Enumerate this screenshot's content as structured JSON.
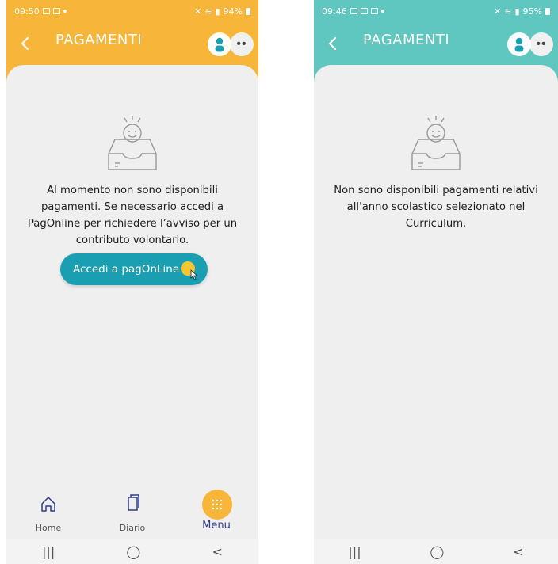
{
  "left_screen": {
    "status": {
      "time": "09:50",
      "battery": "94%"
    },
    "title": "PAGAMENTI",
    "message": "Al momento non sono disponibili pagamenti. Se necessario accedi a PagOnline per richiedere l’avviso per un contributo volontario.",
    "button_label": "Accedi a pagOnLine",
    "nav": {
      "home": "Home",
      "diario": "Diario",
      "menu": "Menu"
    },
    "colors": {
      "header": "#f7b63a",
      "button": "#1a9fb2",
      "menu_circle": "#f7b63a"
    }
  },
  "right_screen": {
    "status": {
      "time": "09:46",
      "battery": "95%"
    },
    "title": "PAGAMENTI",
    "message": "Non sono disponibili pagamenti relativi all'anno scolastico selezionato nel Curriculum.",
    "colors": {
      "header": "#5fc6c0"
    }
  },
  "icons": {
    "back": "chevron-left-icon",
    "avatar": "user-avatar-icon",
    "more": "more-dots-icon",
    "empty": "empty-inbox-icon",
    "home": "home-icon",
    "diario": "bookmark-icon",
    "menu": "menu-grid-icon"
  }
}
